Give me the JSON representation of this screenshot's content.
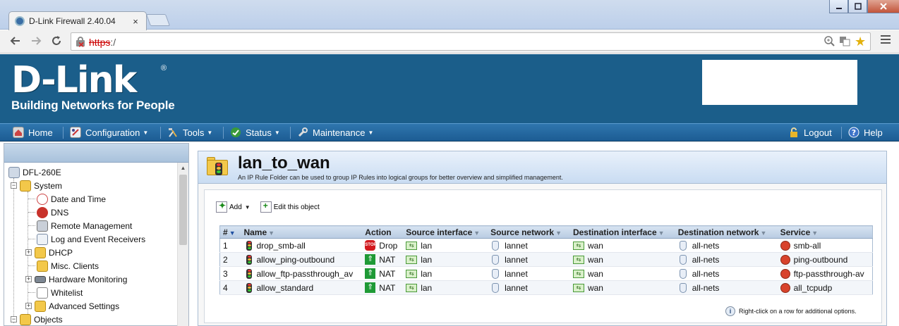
{
  "browser": {
    "tab_title": "D-Link Firewall 2.40.04",
    "tab_close": "×",
    "url_scheme": "https",
    "url_rest": ":/"
  },
  "header": {
    "logo": "D-Link",
    "logo_reg": "®",
    "tagline": "Building Networks for People"
  },
  "menu": {
    "items": [
      {
        "label": "Home"
      },
      {
        "label": "Configuration"
      },
      {
        "label": "Tools"
      },
      {
        "label": "Status"
      },
      {
        "label": "Maintenance"
      }
    ],
    "logout": "Logout",
    "help": "Help"
  },
  "tree": {
    "items": [
      {
        "label": "DFL-260E"
      },
      {
        "label": "System"
      },
      {
        "label": "Date and Time"
      },
      {
        "label": "DNS"
      },
      {
        "label": "Remote Management"
      },
      {
        "label": "Log and Event Receivers"
      },
      {
        "label": "DHCP"
      },
      {
        "label": "Misc. Clients"
      },
      {
        "label": "Hardware Monitoring"
      },
      {
        "label": "Whitelist"
      },
      {
        "label": "Advanced Settings"
      },
      {
        "label": "Objects"
      }
    ]
  },
  "main": {
    "title": "lan_to_wan",
    "description": "An IP Rule Folder can be used to group IP Rules into logical groups for better overview and simplified management.",
    "add_label": "Add",
    "edit_label": "Edit this object",
    "hint": "Right-click on a row for additional options."
  },
  "table": {
    "columns": [
      "#",
      "Name",
      "Action",
      "Source interface",
      "Source network",
      "Destination interface",
      "Destination network",
      "Service"
    ],
    "rows": [
      {
        "num": "1",
        "name": "drop_smb-all",
        "action": "Drop",
        "src_if": "lan",
        "src_net": "lannet",
        "dst_if": "wan",
        "dst_net": "all-nets",
        "service": "smb-all"
      },
      {
        "num": "2",
        "name": "allow_ping-outbound",
        "action": "NAT",
        "src_if": "lan",
        "src_net": "lannet",
        "dst_if": "wan",
        "dst_net": "all-nets",
        "service": "ping-outbound"
      },
      {
        "num": "3",
        "name": "allow_ftp-passthrough_av",
        "action": "NAT",
        "src_if": "lan",
        "src_net": "lannet",
        "dst_if": "wan",
        "dst_net": "all-nets",
        "service": "ftp-passthrough-av"
      },
      {
        "num": "4",
        "name": "allow_standard",
        "action": "NAT",
        "src_if": "lan",
        "src_net": "lannet",
        "dst_if": "wan",
        "dst_net": "all-nets",
        "service": "all_tcpudp"
      }
    ]
  },
  "colors": {
    "brand_blue": "#1b5e8a",
    "menu_blue": "#2368a1"
  }
}
